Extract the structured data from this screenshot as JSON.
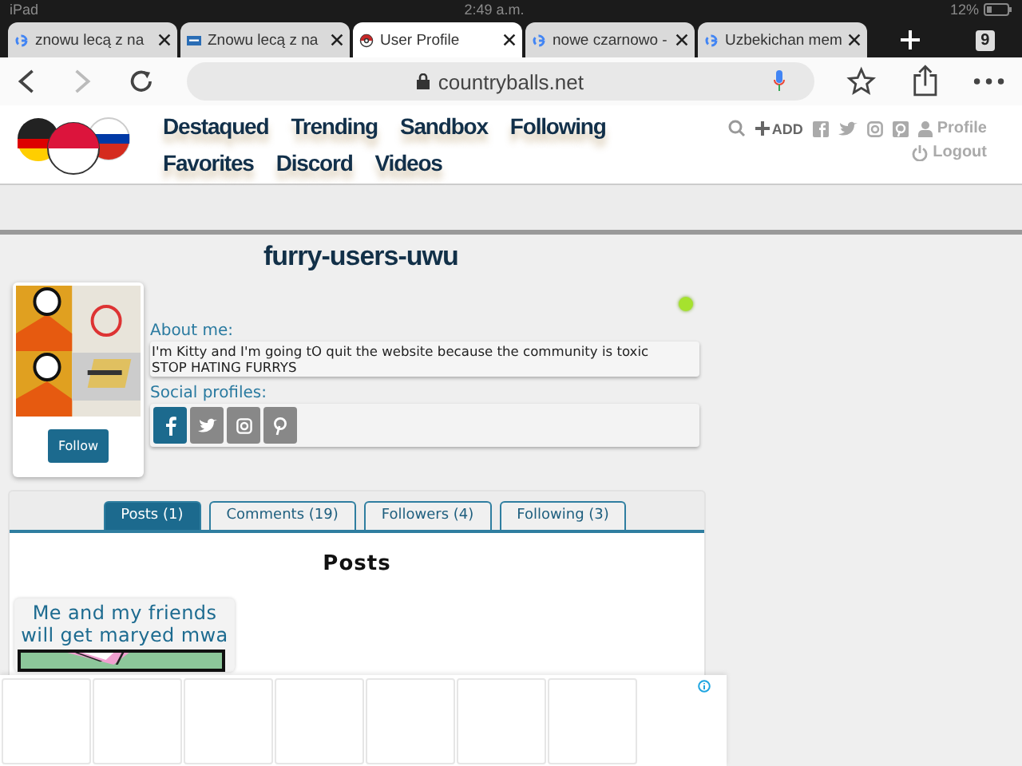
{
  "status_bar": {
    "device": "iPad",
    "time": "2:49 a.m.",
    "battery": "12%"
  },
  "browser_tabs": [
    {
      "title": "znowu lecą z na",
      "kind": "google",
      "selected": false
    },
    {
      "title": "Znowu lecą z na",
      "kind": "site",
      "selected": false
    },
    {
      "title": "User Profile",
      "kind": "ball",
      "selected": true
    },
    {
      "title": "nowe czarnowo -",
      "kind": "google",
      "selected": false
    },
    {
      "title": "Uzbekichan mem",
      "kind": "google",
      "selected": false
    }
  ],
  "tab_count": "9",
  "address_bar": {
    "url": "countryballs.net"
  },
  "site_nav": {
    "links": [
      "Destaqued",
      "Trending",
      "Sandbox",
      "Following",
      "Favorites",
      "Discord",
      "Videos"
    ],
    "add": "ADD",
    "profile": "Profile",
    "logout": "Logout"
  },
  "profile": {
    "username": "furry-users-uwu",
    "online": true,
    "follow": "Follow",
    "about_label": "About me:",
    "about_lines": [
      "I'm Kitty and I'm going tO quit the website because the community is toxic",
      "STOP HATING FURRYS"
    ],
    "social_label": "Social profiles:",
    "social": [
      {
        "kind": "facebook",
        "highlighted": true
      },
      {
        "kind": "twitter",
        "highlighted": false
      },
      {
        "kind": "instagram",
        "highlighted": false
      },
      {
        "kind": "pinterest",
        "highlighted": false
      }
    ]
  },
  "profile_tabs": [
    {
      "label": "Posts (1)",
      "selected": true
    },
    {
      "label": "Comments (19)",
      "selected": false
    },
    {
      "label": "Followers (4)",
      "selected": false
    },
    {
      "label": "Following (3)",
      "selected": false
    }
  ],
  "posts_heading": "Posts",
  "posts": [
    {
      "title": "Me and my friends will get maryed mwa"
    }
  ]
}
